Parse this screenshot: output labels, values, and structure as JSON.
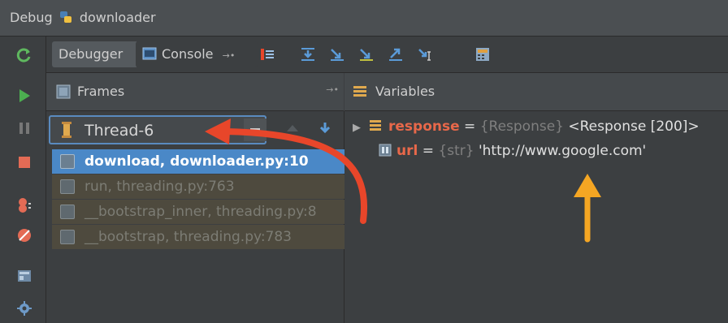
{
  "window": {
    "title": "Debug",
    "config_name": "downloader"
  },
  "tabs": [
    {
      "label": "Debugger"
    },
    {
      "label": "Console"
    }
  ],
  "panels": {
    "frames_title": "Frames",
    "variables_title": "Variables"
  },
  "thread": {
    "selected": "Thread-6"
  },
  "frames": [
    {
      "label": "download, downloader.py:10"
    },
    {
      "label": "run, threading.py:763"
    },
    {
      "label": "__bootstrap_inner, threading.py:8"
    },
    {
      "label": "__bootstrap, threading.py:783"
    }
  ],
  "variables": [
    {
      "name": "response",
      "eq": " = ",
      "type": "{Response}",
      "value": " <Response [200]>"
    },
    {
      "name": "url",
      "eq": " = ",
      "type": "{str}",
      "value": " 'http://www.google.com'"
    }
  ],
  "colors": {
    "accent_red": "#e8462a",
    "accent_orange": "#f5a623",
    "selection": "#4a88c7"
  }
}
